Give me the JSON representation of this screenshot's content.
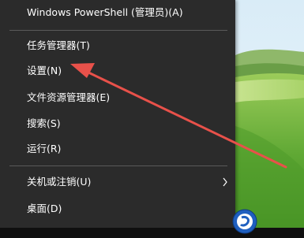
{
  "menu": {
    "items": [
      {
        "id": "powershell-admin",
        "label": "Windows PowerShell (管理员)(A)",
        "has_submenu": false
      },
      {
        "id": "task-manager",
        "label": "任务管理器(T)",
        "has_submenu": false
      },
      {
        "id": "settings",
        "label": "设置(N)",
        "has_submenu": false
      },
      {
        "id": "file-explorer",
        "label": "文件资源管理器(E)",
        "has_submenu": false
      },
      {
        "id": "search",
        "label": "搜索(S)",
        "has_submenu": false
      },
      {
        "id": "run",
        "label": "运行(R)",
        "has_submenu": false
      },
      {
        "id": "shutdown-signout",
        "label": "关机或注销(U)",
        "has_submenu": true
      },
      {
        "id": "desktop",
        "label": "桌面(D)",
        "has_submenu": false
      }
    ],
    "submenu_arrow_icon": "chevron-right-icon",
    "background_color": "#2b2b2b",
    "text_color": "#ffffff"
  },
  "annotation": {
    "icon": "red-arrow",
    "color": "#e8514a",
    "points_to": "settings"
  },
  "taskbar": {
    "app_icon": "blue-circle-app-icon"
  }
}
